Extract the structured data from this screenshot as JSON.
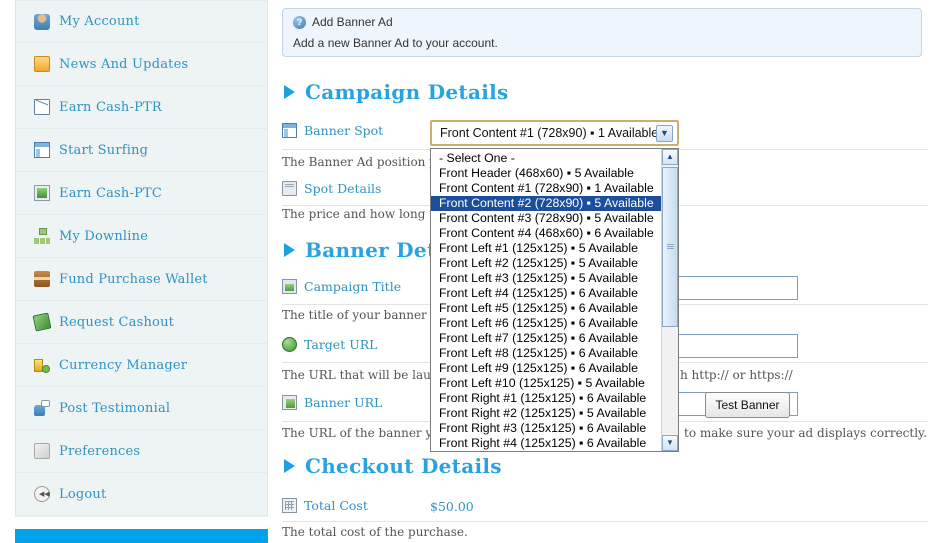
{
  "sidebar": {
    "items": [
      {
        "label": "My Account",
        "icon": "person-icon",
        "icon_class": "ic-person"
      },
      {
        "label": "News And Updates",
        "icon": "news-icon",
        "icon_class": "ic-news"
      },
      {
        "label": "Earn Cash-PTR",
        "icon": "envelope-icon",
        "icon_class": "ic-mail"
      },
      {
        "label": "Start Surfing",
        "icon": "browser-window-icon",
        "icon_class": "ic-surf"
      },
      {
        "label": "Earn Cash-PTC",
        "icon": "monitor-icon",
        "icon_class": "ic-ptc"
      },
      {
        "label": "My Downline",
        "icon": "org-chart-icon",
        "icon_class": "ic-downline"
      },
      {
        "label": "Fund Purchase Wallet",
        "icon": "treasure-chest-icon",
        "icon_class": "ic-wallet"
      },
      {
        "label": "Request Cashout",
        "icon": "money-icon",
        "icon_class": "ic-cash"
      },
      {
        "label": "Currency Manager",
        "icon": "coins-icon",
        "icon_class": "ic-currency"
      },
      {
        "label": "Post Testimonial",
        "icon": "user-comment-icon",
        "icon_class": "ic-testimonial"
      },
      {
        "label": "Preferences",
        "icon": "package-icon",
        "icon_class": "ic-prefs"
      },
      {
        "label": "Logout",
        "icon": "rewind-icon",
        "icon_class": "ic-logout"
      }
    ]
  },
  "info_box": {
    "icon": "help-circle-icon",
    "icon_glyph": "?",
    "title": "Add Banner Ad",
    "description": "Add a new Banner Ad to your account."
  },
  "sections": {
    "campaign_details": {
      "title": "Campaign Details",
      "rows": [
        {
          "label": "Banner Spot",
          "icon": "banner-spot-icon",
          "icon_class": "ic-spot",
          "help": "The Banner Ad position you"
        },
        {
          "label": "Spot Details",
          "icon": "spot-details-icon",
          "icon_class": "ic-details",
          "help": "The price and how long the"
        }
      ]
    },
    "banner_details": {
      "title": "Banner Deta",
      "full_title": "Banner Details",
      "rows": [
        {
          "label": "Campaign Title",
          "icon": "campaign-title-icon",
          "icon_class": "ic-campaign",
          "help": "The title of your banner ad."
        },
        {
          "label": "Target URL",
          "icon": "globe-icon",
          "icon_class": "ic-globe",
          "help": "The URL that will be launch",
          "help_right": "h http:// or https://"
        },
        {
          "label": "Banner URL",
          "icon": "banner-url-icon",
          "icon_class": "ic-banner",
          "help": "The URL of the banner you",
          "help_right": "to make sure your ad displays correctly."
        }
      ]
    },
    "checkout_details": {
      "title": "Checkout Details",
      "rows": [
        {
          "label": "Total Cost",
          "icon": "calculator-icon",
          "icon_class": "ic-calc",
          "value": "$50.00",
          "help": "The total cost of the purchase."
        }
      ]
    }
  },
  "test_banner_button": {
    "label": "Test Banner"
  },
  "banner_spot_select": {
    "selected_value": "Front Content #1 (728x90) ▪ 1 Available",
    "arrow_icon": "chevron-down-icon",
    "arrow_glyph": "▼",
    "expanded": true,
    "highlighted_index": 3,
    "options": [
      "- Select One -",
      "Front Header (468x60) ▪ 5 Available",
      "Front Content #1 (728x90) ▪ 1 Available",
      "Front Content #2 (728x90) ▪ 5 Available",
      "Front Content #3 (728x90) ▪ 5 Available",
      "Front Content #4 (468x60) ▪ 6 Available",
      "Front Left #1 (125x125) ▪ 5 Available",
      "Front Left #2 (125x125) ▪ 5 Available",
      "Front Left #3 (125x125) ▪ 5 Available",
      "Front Left #4 (125x125) ▪ 6 Available",
      "Front Left #5 (125x125) ▪ 6 Available",
      "Front Left #6 (125x125) ▪ 6 Available",
      "Front Left #7 (125x125) ▪ 6 Available",
      "Front Left #8 (125x125) ▪ 6 Available",
      "Front Left #9 (125x125) ▪ 6 Available",
      "Front Left #10 (125x125) ▪ 5 Available",
      "Front Right #1 (125x125) ▪ 6 Available",
      "Front Right #2 (125x125) ▪ 5 Available",
      "Front Right #3 (125x125) ▪ 6 Available",
      "Front Right #4 (125x125) ▪ 6 Available"
    ],
    "scrollbar": {
      "up_icon": "scroll-up-icon",
      "up_glyph": "▲",
      "down_icon": "scroll-down-icon",
      "down_glyph": "▼"
    }
  },
  "colors": {
    "accent_blue": "#29a3e0",
    "link_blue": "#2e93c4",
    "sidebar_bg": "#eef4f4",
    "info_bg": "#eef5fd",
    "select_focus_border": "#cbb069",
    "option_highlight": "#1b4f9c",
    "bottom_bar": "#00a3e9"
  }
}
